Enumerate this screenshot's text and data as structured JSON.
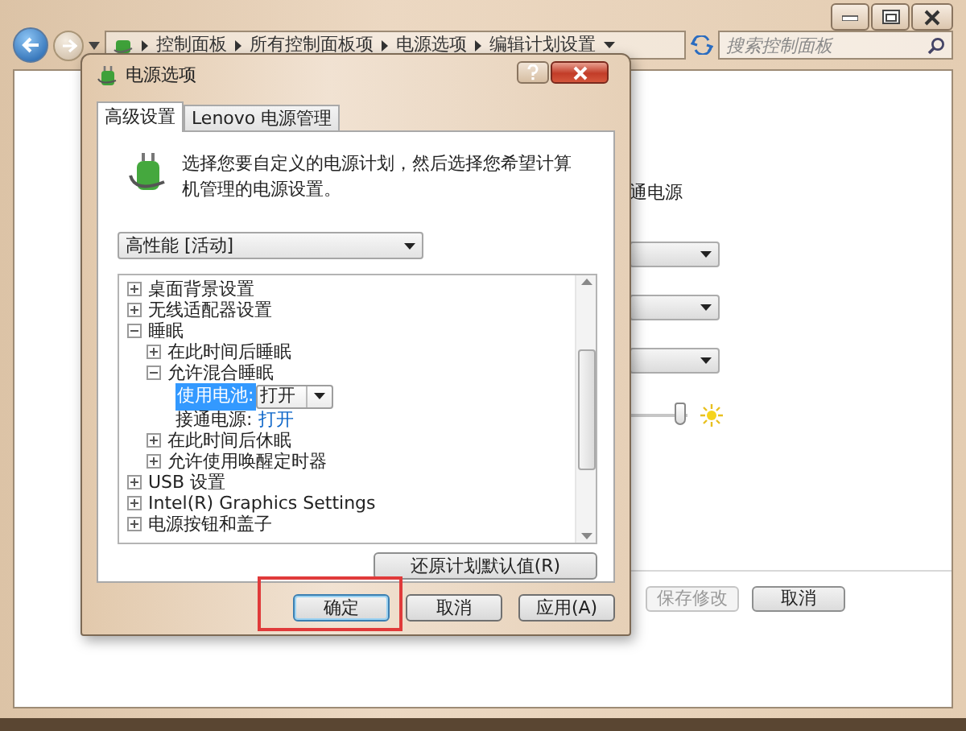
{
  "address_bar": {
    "breadcrumbs": [
      "控制面板",
      "所有控制面板项",
      "电源选项",
      "编辑计划设置"
    ]
  },
  "search": {
    "placeholder": "搜索控制面板"
  },
  "background_page": {
    "column_header": "通电源",
    "brightness_slider": {
      "level": 0.85
    },
    "buttons": [
      {
        "label": "保存修改",
        "disabled": true
      },
      {
        "label": "取消",
        "disabled": false
      }
    ]
  },
  "dialog": {
    "title": "电源选项",
    "tabs": [
      {
        "label": "高级设置",
        "selected": true
      },
      {
        "label": "Lenovo 电源管理",
        "selected": false
      }
    ],
    "description": "选择您要自定义的电源计划，然后选择您希望计算机管理的电源设置。",
    "plan_select": {
      "value": "高性能 [活动]"
    },
    "settings_tree": [
      {
        "label": "桌面背景设置",
        "expanded": false
      },
      {
        "label": "无线适配器设置",
        "expanded": false
      },
      {
        "label": "睡眠",
        "expanded": true,
        "children": [
          {
            "label": "在此时间后睡眠",
            "expanded": false
          },
          {
            "label": "允许混合睡眠",
            "expanded": true,
            "children": [
              {
                "kind": "dropdown",
                "label": "使用电池:",
                "value": "打开",
                "selected": true
              },
              {
                "kind": "link",
                "label": "接通电源:",
                "value": "打开",
                "selected": false
              }
            ]
          },
          {
            "label": "在此时间后休眠",
            "expanded": false
          },
          {
            "label": "允许使用唤醒定时器",
            "expanded": false
          }
        ]
      },
      {
        "label": "USB 设置",
        "expanded": false
      },
      {
        "label": "Intel(R) Graphics Settings",
        "expanded": false
      },
      {
        "label": "电源按钮和盖子",
        "expanded": false
      }
    ],
    "restore_button": "还原计划默认值(R)",
    "buttons": [
      {
        "label": "确定",
        "default": true,
        "annotated": true
      },
      {
        "label": "取消",
        "default": false,
        "annotated": false
      },
      {
        "label": "应用(A)",
        "default": false,
        "annotated": false
      }
    ]
  }
}
